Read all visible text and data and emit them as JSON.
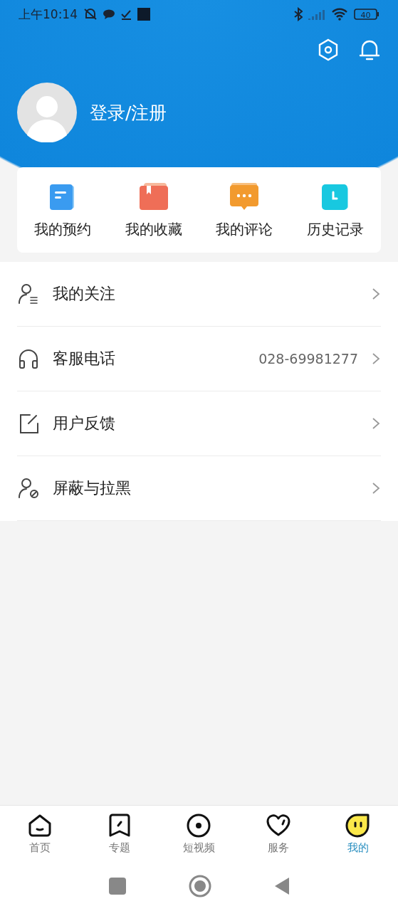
{
  "status_bar": {
    "time": "上午10:14",
    "battery": "40"
  },
  "header": {
    "login_label": "登录/注册"
  },
  "quick_actions": [
    {
      "kind": "booking",
      "label": "我的预约"
    },
    {
      "kind": "favorites",
      "label": "我的收藏"
    },
    {
      "kind": "comments",
      "label": "我的评论"
    },
    {
      "kind": "history",
      "label": "历史记录"
    }
  ],
  "menu": [
    {
      "kind": "follow",
      "label": "我的关注"
    },
    {
      "kind": "phone",
      "label": "客服电话",
      "value": "028-69981277"
    },
    {
      "kind": "feedback",
      "label": "用户反馈"
    },
    {
      "kind": "block",
      "label": "屏蔽与拉黑"
    }
  ],
  "tabs": [
    {
      "kind": "home",
      "label": "首页",
      "selected": false
    },
    {
      "kind": "topic",
      "label": "专题",
      "selected": false
    },
    {
      "kind": "video",
      "label": "短视频",
      "selected": false
    },
    {
      "kind": "service",
      "label": "服务",
      "selected": false
    },
    {
      "kind": "mine",
      "label": "我的",
      "selected": true
    }
  ]
}
